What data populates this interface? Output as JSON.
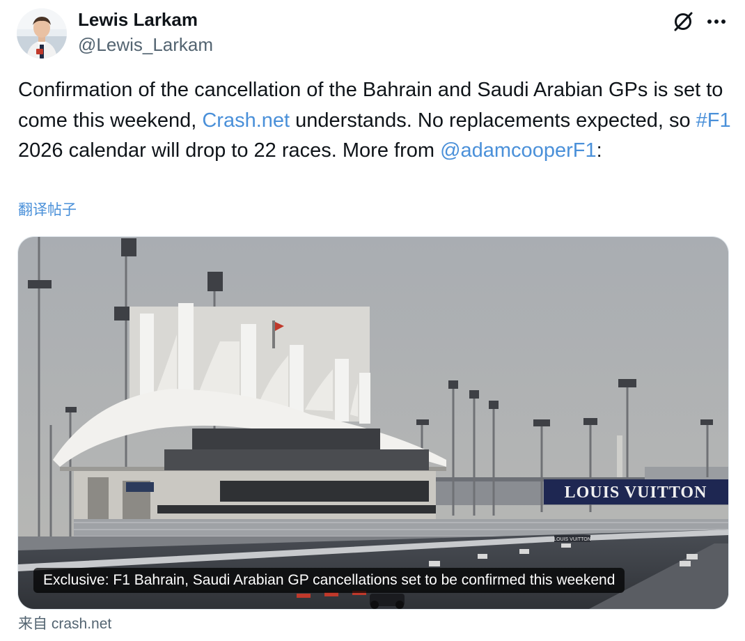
{
  "author": {
    "name": "Lewis Larkam",
    "handle": "@Lewis_Larkam"
  },
  "actions": {
    "grok_icon": "grok-icon",
    "more_icon": "more-icon"
  },
  "tweet": {
    "text_1": "Confirmation of the cancellation of the Bahrain and Saudi Arabian GPs is set to come this weekend, ",
    "link_crash": "Crash.net",
    "text_2": " understands. No replacements expected, so ",
    "hashtag": "#F1",
    "text_3": " 2026 calendar will drop to 22 races. More from ",
    "mention": "@adamcooperF1",
    "text_4": ":",
    "translate_label": "翻译帖子"
  },
  "card": {
    "caption": "Exclusive: F1 Bahrain, Saudi Arabian GP cancellations set to be confirmed this weekend",
    "banner_text": "LOUIS VUITTON",
    "small_sign": "LOUIS VUITTON"
  },
  "source": {
    "prefix": "来自",
    "domain": "crash.net"
  },
  "colors": {
    "link": "#4a90d9",
    "text": "#0f1419",
    "secondary": "#536471"
  }
}
